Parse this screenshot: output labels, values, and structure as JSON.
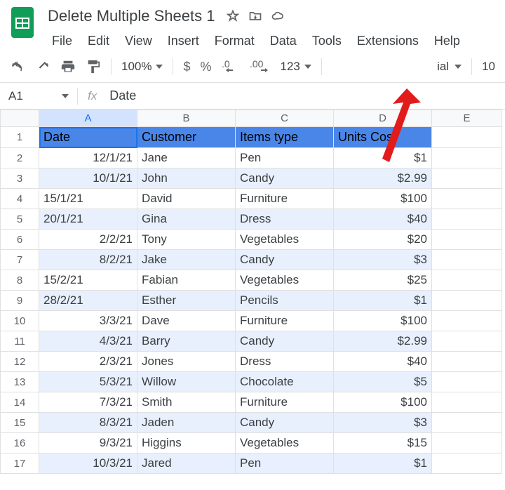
{
  "doc": {
    "title": "Delete Multiple Sheets 1"
  },
  "menu": {
    "file": "File",
    "edit": "Edit",
    "view": "View",
    "insert": "Insert",
    "format": "Format",
    "data": "Data",
    "tools": "Tools",
    "extensions": "Extensions",
    "help": "Help"
  },
  "toolbar": {
    "zoom": "100%",
    "fmt123": "123",
    "fontLabel": "ial",
    "fontSize": "10"
  },
  "nameBox": {
    "ref": "A1",
    "formulaValue": "Date"
  },
  "columns": {
    "A": "A",
    "B": "B",
    "C": "C",
    "D": "D",
    "E": "E"
  },
  "headers": {
    "c0": "Date",
    "c1": "Customer",
    "c2": "Items type",
    "c3": "Units Cost"
  },
  "rows": [
    {
      "n": "1"
    },
    {
      "n": "2",
      "date": "12/1/21",
      "cust": "Jane",
      "item": "Pen",
      "cost": "$1",
      "dateRight": true
    },
    {
      "n": "3",
      "date": "10/1/21",
      "cust": "John",
      "item": "Candy",
      "cost": "$2.99",
      "dateRight": true
    },
    {
      "n": "4",
      "date": "15/1/21",
      "cust": "David",
      "item": "Furniture",
      "cost": "$100",
      "dateRight": false
    },
    {
      "n": "5",
      "date": "20/1/21",
      "cust": "Gina",
      "item": "Dress",
      "cost": "$40",
      "dateRight": false
    },
    {
      "n": "6",
      "date": "2/2/21",
      "cust": "Tony",
      "item": "Vegetables",
      "cost": "$20",
      "dateRight": true
    },
    {
      "n": "7",
      "date": "8/2/21",
      "cust": "Jake",
      "item": "Candy",
      "cost": "$3",
      "dateRight": true
    },
    {
      "n": "8",
      "date": "15/2/21",
      "cust": "Fabian",
      "item": "Vegetables",
      "cost": "$25",
      "dateRight": false
    },
    {
      "n": "9",
      "date": "28/2/21",
      "cust": "Esther",
      "item": "Pencils",
      "cost": "$1",
      "dateRight": false
    },
    {
      "n": "10",
      "date": "3/3/21",
      "cust": "Dave",
      "item": "Furniture",
      "cost": "$100",
      "dateRight": true
    },
    {
      "n": "11",
      "date": "4/3/21",
      "cust": "Barry",
      "item": "Candy",
      "cost": "$2.99",
      "dateRight": true
    },
    {
      "n": "12",
      "date": "2/3/21",
      "cust": "Jones",
      "item": "Dress",
      "cost": "$40",
      "dateRight": true
    },
    {
      "n": "13",
      "date": "5/3/21",
      "cust": "Willow",
      "item": "Chocolate",
      "cost": "$5",
      "dateRight": true
    },
    {
      "n": "14",
      "date": "7/3/21",
      "cust": "Smith",
      "item": "Furniture",
      "cost": "$100",
      "dateRight": true
    },
    {
      "n": "15",
      "date": "8/3/21",
      "cust": "Jaden",
      "item": "Candy",
      "cost": "$3",
      "dateRight": true
    },
    {
      "n": "16",
      "date": "9/3/21",
      "cust": "Higgins",
      "item": "Vegetables",
      "cost": "$15",
      "dateRight": true
    },
    {
      "n": "17",
      "date": "10/3/21",
      "cust": "Jared",
      "item": "Pen",
      "cost": "$1",
      "dateRight": true
    }
  ]
}
